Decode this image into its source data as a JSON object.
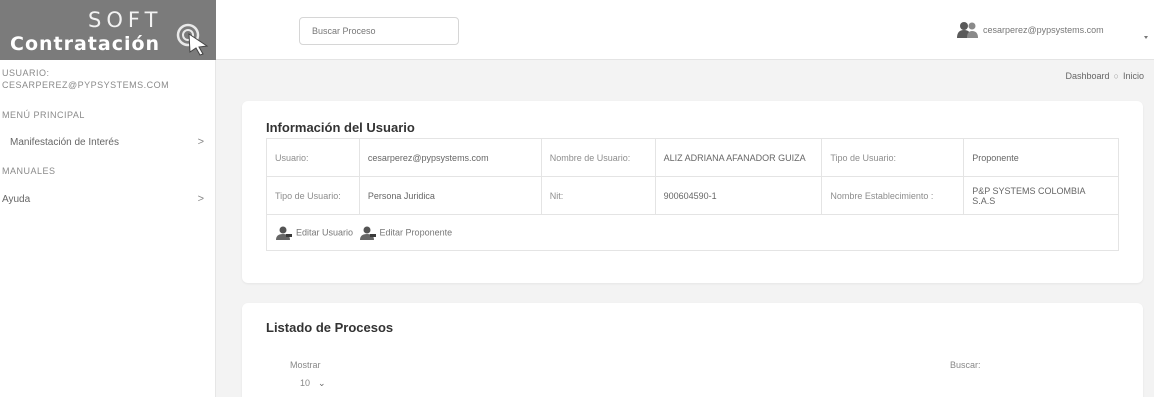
{
  "logo": {
    "line1": "SOFT",
    "line2": "Contratación"
  },
  "sidebar": {
    "user_label": "USUARIO:",
    "user_value": "CESARPEREZ@PYPSYSTEMS.COM",
    "menu_heading": "MENÚ PRINCIPAL",
    "manifestacion_label": "Manifestación de Interés",
    "manuales_heading": "MANUALES",
    "ayuda_label": "Ayuda",
    "chevron": ">"
  },
  "topbar": {
    "search_placeholder": "Buscar Proceso",
    "user_email": "cesarperez@pypsystems.com"
  },
  "breadcrumb": {
    "dashboard": "Dashboard",
    "separator": "○",
    "inicio": "Inicio"
  },
  "user_info": {
    "title": "Información del Usuario",
    "usuario_label": "Usuario:",
    "usuario_value": "cesarperez@pypsystems.com",
    "nombre_label": "Nombre de Usuario:",
    "nombre_value": "ALIZ ADRIANA AFANADOR GUIZA",
    "tipo_label": "Tipo de Usuario:",
    "tipo_value": "Proponente",
    "tipo2_label": "Tipo de Usuario:",
    "tipo2_value": "Persona Juridica",
    "nit_label": "Nit:",
    "nit_value": "900604590-1",
    "establecimiento_label": "Nombre Establecimiento :",
    "establecimiento_value": "P&P SYSTEMS COLOMBIA S.A.S",
    "edit_user": "Editar Usuario",
    "edit_proponent": "Editar Proponente"
  },
  "process_list": {
    "title": "Listado de Procesos",
    "show_label": "Mostrar",
    "show_value": "10",
    "search_label": "Buscar:"
  },
  "colors": {
    "logo_bg": "#7b7b7b",
    "page_bg": "#f3f3f3",
    "card_bg": "#ffffff"
  },
  "icons": [
    "cursor-icon",
    "users-icon",
    "user-edit-icon",
    "chevron-right-icon",
    "chevron-down-icon"
  ]
}
